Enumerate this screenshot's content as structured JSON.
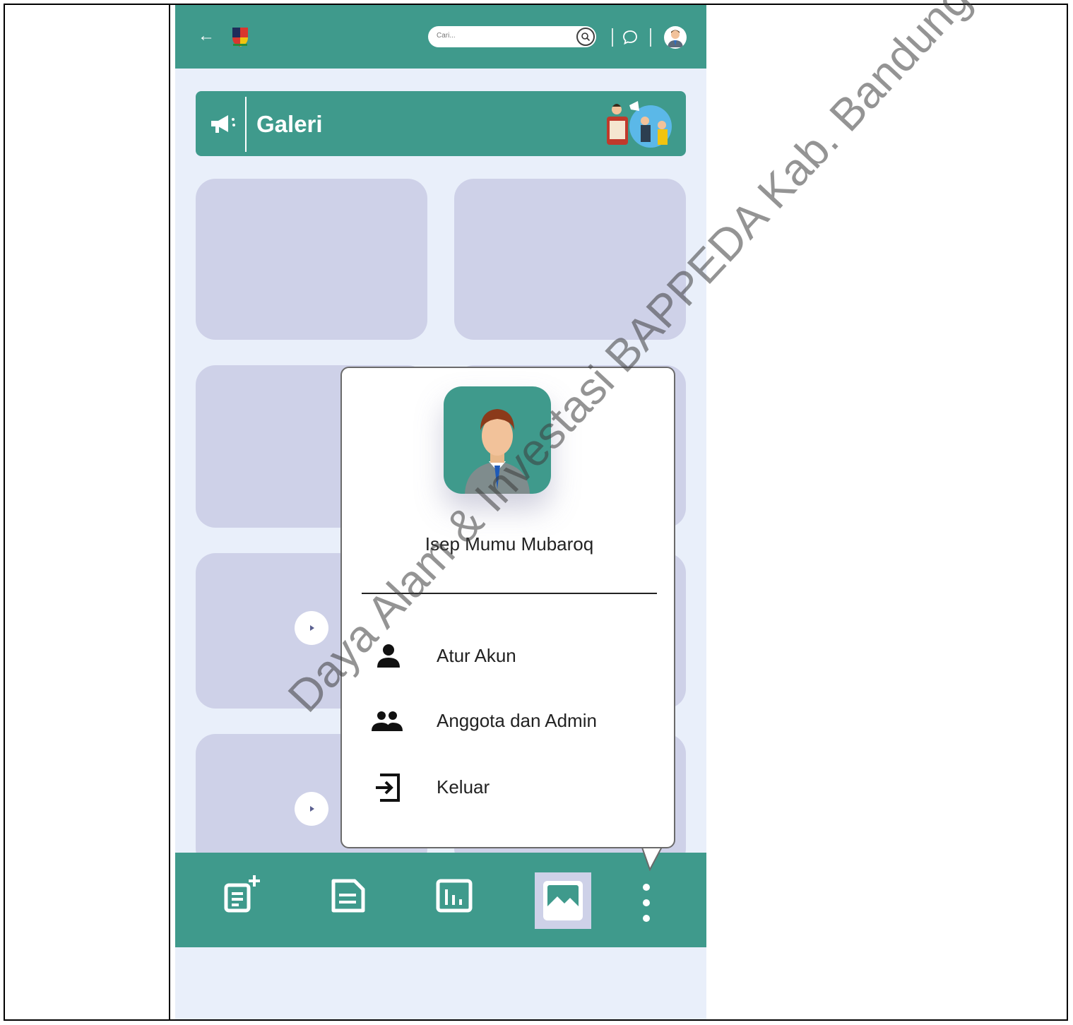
{
  "header": {
    "back_icon": "arrow-left-icon",
    "logo_icon": "kabupaten-crest-icon",
    "search_placeholder": "Cari...",
    "search_icon": "search-icon",
    "chat_icon": "chat-bubble-icon",
    "avatar_icon": "user-avatar-icon"
  },
  "banner": {
    "icon": "megaphone-icon",
    "title": "Galeri",
    "illustration": "people-announcement-illustration"
  },
  "gallery": {
    "card_count": 8,
    "video_cards_with_play": 2,
    "play_icon": "play-icon"
  },
  "profile_menu": {
    "name": "Isep Mumu Mubaroq",
    "items": [
      {
        "label": "Atur Akun",
        "icon": "person-icon"
      },
      {
        "label": "Anggota dan Admin",
        "icon": "group-icon"
      },
      {
        "label": "Keluar",
        "icon": "logout-icon"
      }
    ]
  },
  "bottom_nav": {
    "items": [
      {
        "icon": "add-post-icon"
      },
      {
        "icon": "document-icon"
      },
      {
        "icon": "chart-icon"
      },
      {
        "icon": "image-gallery-icon",
        "active": true
      },
      {
        "icon": "more-vertical-icon"
      }
    ]
  },
  "watermark": "Daya Alam & Investasi BAPPEDA Kab. Bandung",
  "colors": {
    "primary": "#3f9a8c",
    "background": "#e9effa",
    "card": "#ced1e8"
  }
}
